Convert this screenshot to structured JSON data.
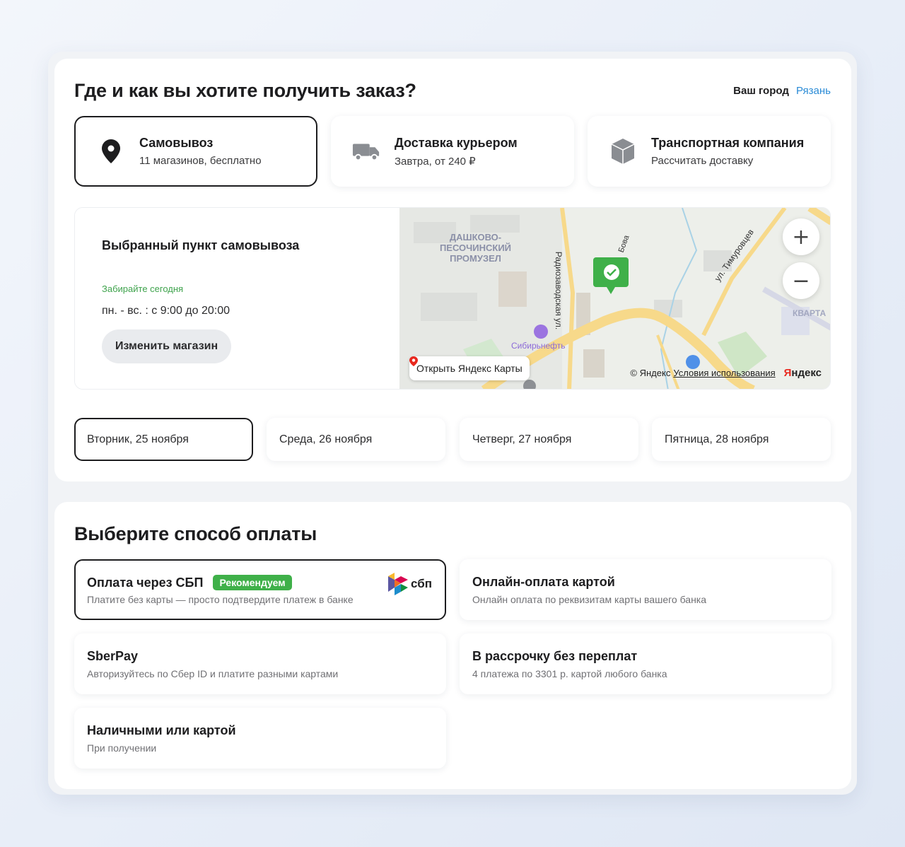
{
  "delivery": {
    "title": "Где и как вы хотите получить заказ?",
    "city_label": "Ваш город",
    "city_value": "Рязань",
    "options": [
      {
        "title": "Самовывоз",
        "subtitle": "11 магазинов, бесплатно",
        "icon": "map-pin-icon",
        "selected": true
      },
      {
        "title": "Доставка курьером",
        "subtitle": "Завтра, от 240 ₽",
        "icon": "truck-icon",
        "selected": false
      },
      {
        "title": "Транспортная компания",
        "subtitle": "Рассчитать доставку",
        "icon": "box-icon",
        "selected": false
      }
    ],
    "pickup": {
      "title": "Выбранный пункт самовывоза",
      "availability": "Забирайте сегодня",
      "hours": "пн. - вс. : с 9:00 до 20:00",
      "change_button": "Изменить магазин"
    },
    "map": {
      "labels": {
        "district": "ДАШКОВО-\nПЕСОЧИНСКИЙ\nПРОМУЗЕЛ",
        "street1": "Радиозаводская ул.",
        "street2": "ул. Тимуровцев",
        "street3": "Бова",
        "poi": "Сибирьнефть",
        "quarter": "КВАРТА"
      },
      "zoom_in": "+",
      "zoom_out": "−",
      "open_label": "Открыть Яндекс Карты",
      "copyright": "© Яндекс",
      "terms": "Условия использования",
      "brand_prefix": "Я",
      "brand_rest": "ндекс"
    },
    "days": [
      {
        "label": "Вторник, 25 ноября",
        "selected": true
      },
      {
        "label": "Среда, 26 ноября",
        "selected": false
      },
      {
        "label": "Четверг, 27 ноября",
        "selected": false
      },
      {
        "label": "Пятница, 28 ноября",
        "selected": false
      }
    ]
  },
  "payment": {
    "title": "Выберите способ оплаты",
    "methods": [
      {
        "title": "Оплата через СБП",
        "badge": "Рекомендуем",
        "subtitle": "Платите без карты — просто подтвердите платеж в банке",
        "logo_text": "сбп",
        "selected": true
      },
      {
        "title": "Онлайн-оплата картой",
        "subtitle": "Онлайн оплата по реквизитам карты вашего банка",
        "selected": false
      },
      {
        "title": "SberPay",
        "subtitle": "Авторизуйтесь по Сбер ID и платите разными картами",
        "selected": false
      },
      {
        "title": "В рассрочку без переплат",
        "subtitle": "4 платежа по 3301 р. картой любого банка",
        "selected": false
      },
      {
        "title": "Наличными или картой",
        "subtitle": "При получении",
        "selected": false
      }
    ]
  },
  "colors": {
    "accent_link": "#2a8bd6",
    "success_green": "#3fa34d",
    "badge_green": "#3fb049",
    "selected_border": "#1d1d1f"
  }
}
